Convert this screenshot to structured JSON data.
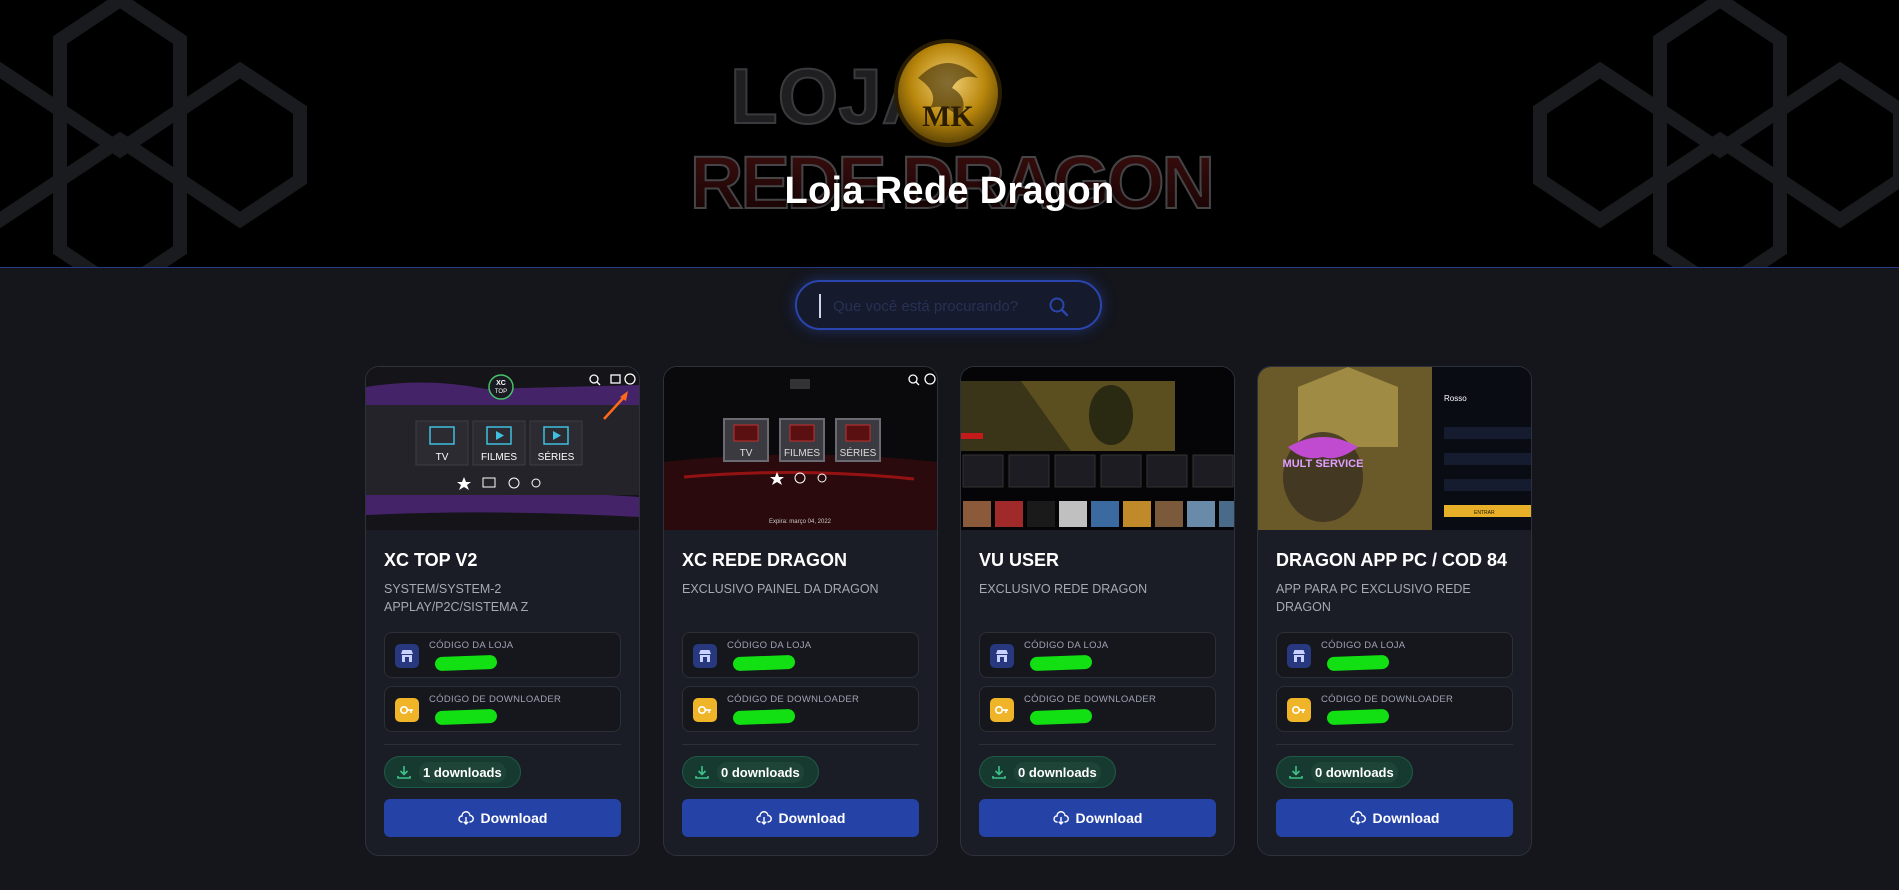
{
  "site": {
    "title": "Loja Rede Dragon",
    "logo_text": "LOJA REDE DRAGON",
    "logo_emblem": "MK"
  },
  "search": {
    "placeholder": "Que você está procurando?",
    "icon": "search-icon"
  },
  "colors": {
    "accent": "#2542a7",
    "card_bg": "#1a1d26",
    "page_bg": "#14161c",
    "download_badge": "#163a30",
    "downloader_icon": "#f0b428"
  },
  "labels": {
    "store_code": "CÓDIGO DA LOJA",
    "downloader_code": "CÓDIGO DE DOWNLOADER",
    "download_button": "Download"
  },
  "cards": [
    {
      "title": "XC TOP V2",
      "description": "SYSTEM/SYSTEM-2 APPLAY/P2C/SISTEMA Z",
      "store_code": "(redacted)",
      "downloader_code": "(redacted)",
      "downloads": "1 downloads",
      "thumb": {
        "brand": "XC TOP",
        "menu": [
          "TV",
          "FILMES",
          "SÉRIES"
        ]
      }
    },
    {
      "title": "XC REDE DRAGON",
      "description": "EXCLUSIVO PAINEL DA DRAGON",
      "store_code": "(redacted)",
      "downloader_code": "(redacted)",
      "downloads": "0 downloads",
      "thumb": {
        "menu": [
          "TV",
          "FILMES",
          "SÉRIES"
        ],
        "footer": "Expira: março 04, 2022"
      }
    },
    {
      "title": "VU USER",
      "description": "EXCLUSIVO REDE DRAGON",
      "store_code": "(redacted)",
      "downloader_code": "(redacted)",
      "downloads": "0 downloads",
      "thumb": {}
    },
    {
      "title": "DRAGON APP PC / COD 84",
      "description": "APP PARA PC EXCLUSIVO REDE DRAGON",
      "store_code": "(redacted)",
      "downloader_code": "(redacted)",
      "downloads": "0 downloads",
      "thumb": {
        "brand": "MULT SERVICE",
        "login_title": "Rosso",
        "login_button": "ENTRAR"
      }
    }
  ]
}
